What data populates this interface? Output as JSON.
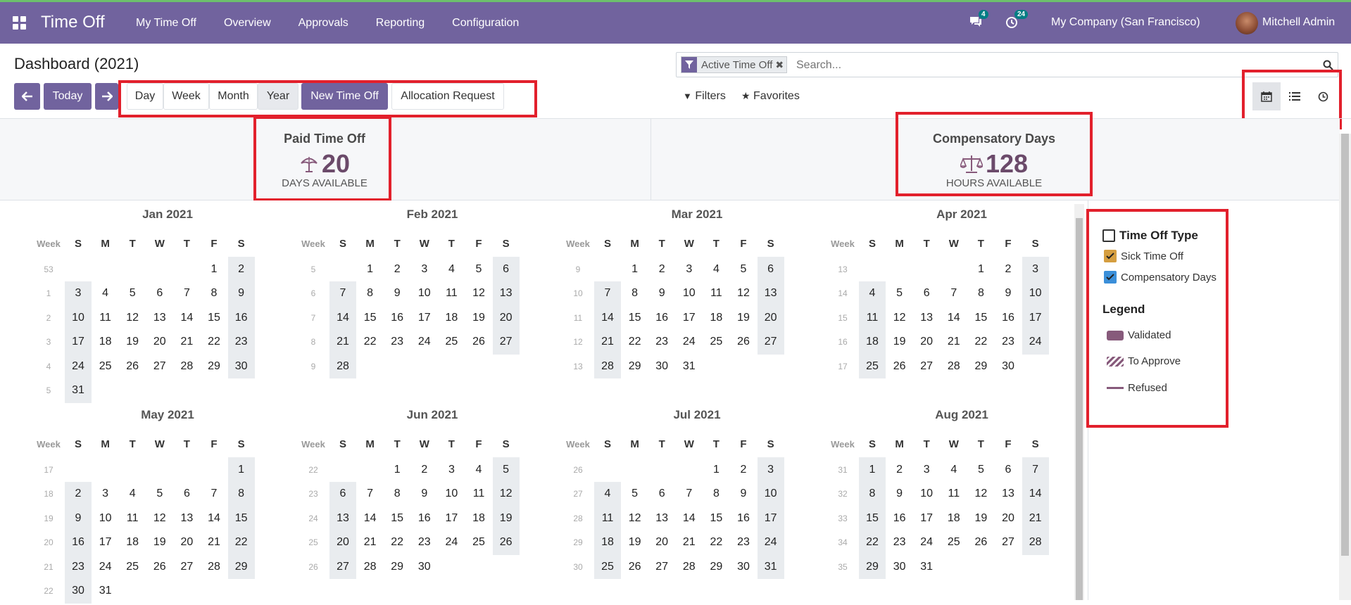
{
  "navbar": {
    "app_title": "Time Off",
    "menu": [
      "My Time Off",
      "Overview",
      "Approvals",
      "Reporting",
      "Configuration"
    ],
    "messages_badge": "4",
    "activity_badge": "24",
    "company": "My Company (San Francisco)",
    "user": "Mitchell Admin",
    "color": "#71639e"
  },
  "page": {
    "title": "Dashboard (2021)"
  },
  "toolbar": {
    "prev_icon": "arrow-left-icon",
    "today": "Today",
    "next_icon": "arrow-right-icon",
    "scales": [
      "Day",
      "Week",
      "Month",
      "Year"
    ],
    "active_scale": "Year",
    "new_time_off": "New Time Off",
    "allocation_request": "Allocation Request"
  },
  "search": {
    "facet": "Active Time Off",
    "placeholder": "Search...",
    "filters": "Filters",
    "favorites": "Favorites"
  },
  "views": [
    "calendar-icon",
    "list-icon",
    "clock-icon"
  ],
  "summary": {
    "paid": {
      "title": "Paid Time Off",
      "value": "20",
      "unit": "DAYS AVAILABLE",
      "icon": "umbrella-icon"
    },
    "comp": {
      "title": "Compensatory Days",
      "value": "128",
      "unit": "HOURS AVAILABLE",
      "icon": "scale-icon"
    }
  },
  "calendar": {
    "week_label": "Week",
    "weekdays": [
      "S",
      "M",
      "T",
      "W",
      "T",
      "F",
      "S"
    ],
    "months": [
      {
        "name": "Jan 2021",
        "weeks": [
          "53",
          "1",
          "2",
          "3",
          "4",
          "5"
        ],
        "start": 5,
        "days": 31
      },
      {
        "name": "Feb 2021",
        "weeks": [
          "5",
          "6",
          "7",
          "8",
          "9"
        ],
        "start": 1,
        "days": 28
      },
      {
        "name": "Mar 2021",
        "weeks": [
          "9",
          "10",
          "11",
          "12",
          "13"
        ],
        "start": 1,
        "days": 31
      },
      {
        "name": "Apr 2021",
        "weeks": [
          "13",
          "14",
          "15",
          "16",
          "17"
        ],
        "start": 4,
        "days": 30
      },
      {
        "name": "May 2021",
        "weeks": [
          "17",
          "18",
          "19",
          "20",
          "21",
          "22"
        ],
        "start": 6,
        "days": 31
      },
      {
        "name": "Jun 2021",
        "weeks": [
          "22",
          "23",
          "24",
          "25",
          "26"
        ],
        "start": 2,
        "days": 30
      },
      {
        "name": "Jul 2021",
        "weeks": [
          "26",
          "27",
          "28",
          "29",
          "30"
        ],
        "start": 4,
        "days": 31
      },
      {
        "name": "Aug 2021",
        "weeks": [
          "31",
          "32",
          "33",
          "34",
          "35"
        ],
        "start": 0,
        "days": 31
      }
    ]
  },
  "sidebar": {
    "filter_title": "Time Off Type",
    "types": [
      {
        "label": "Sick Time Off",
        "color": "#d59e40",
        "checked": true
      },
      {
        "label": "Compensatory Days",
        "color": "#3b8fd9",
        "checked": true
      }
    ],
    "legend_title": "Legend",
    "legend": [
      "Validated",
      "To Approve",
      "Refused"
    ],
    "legend_color": "#875a7b"
  }
}
